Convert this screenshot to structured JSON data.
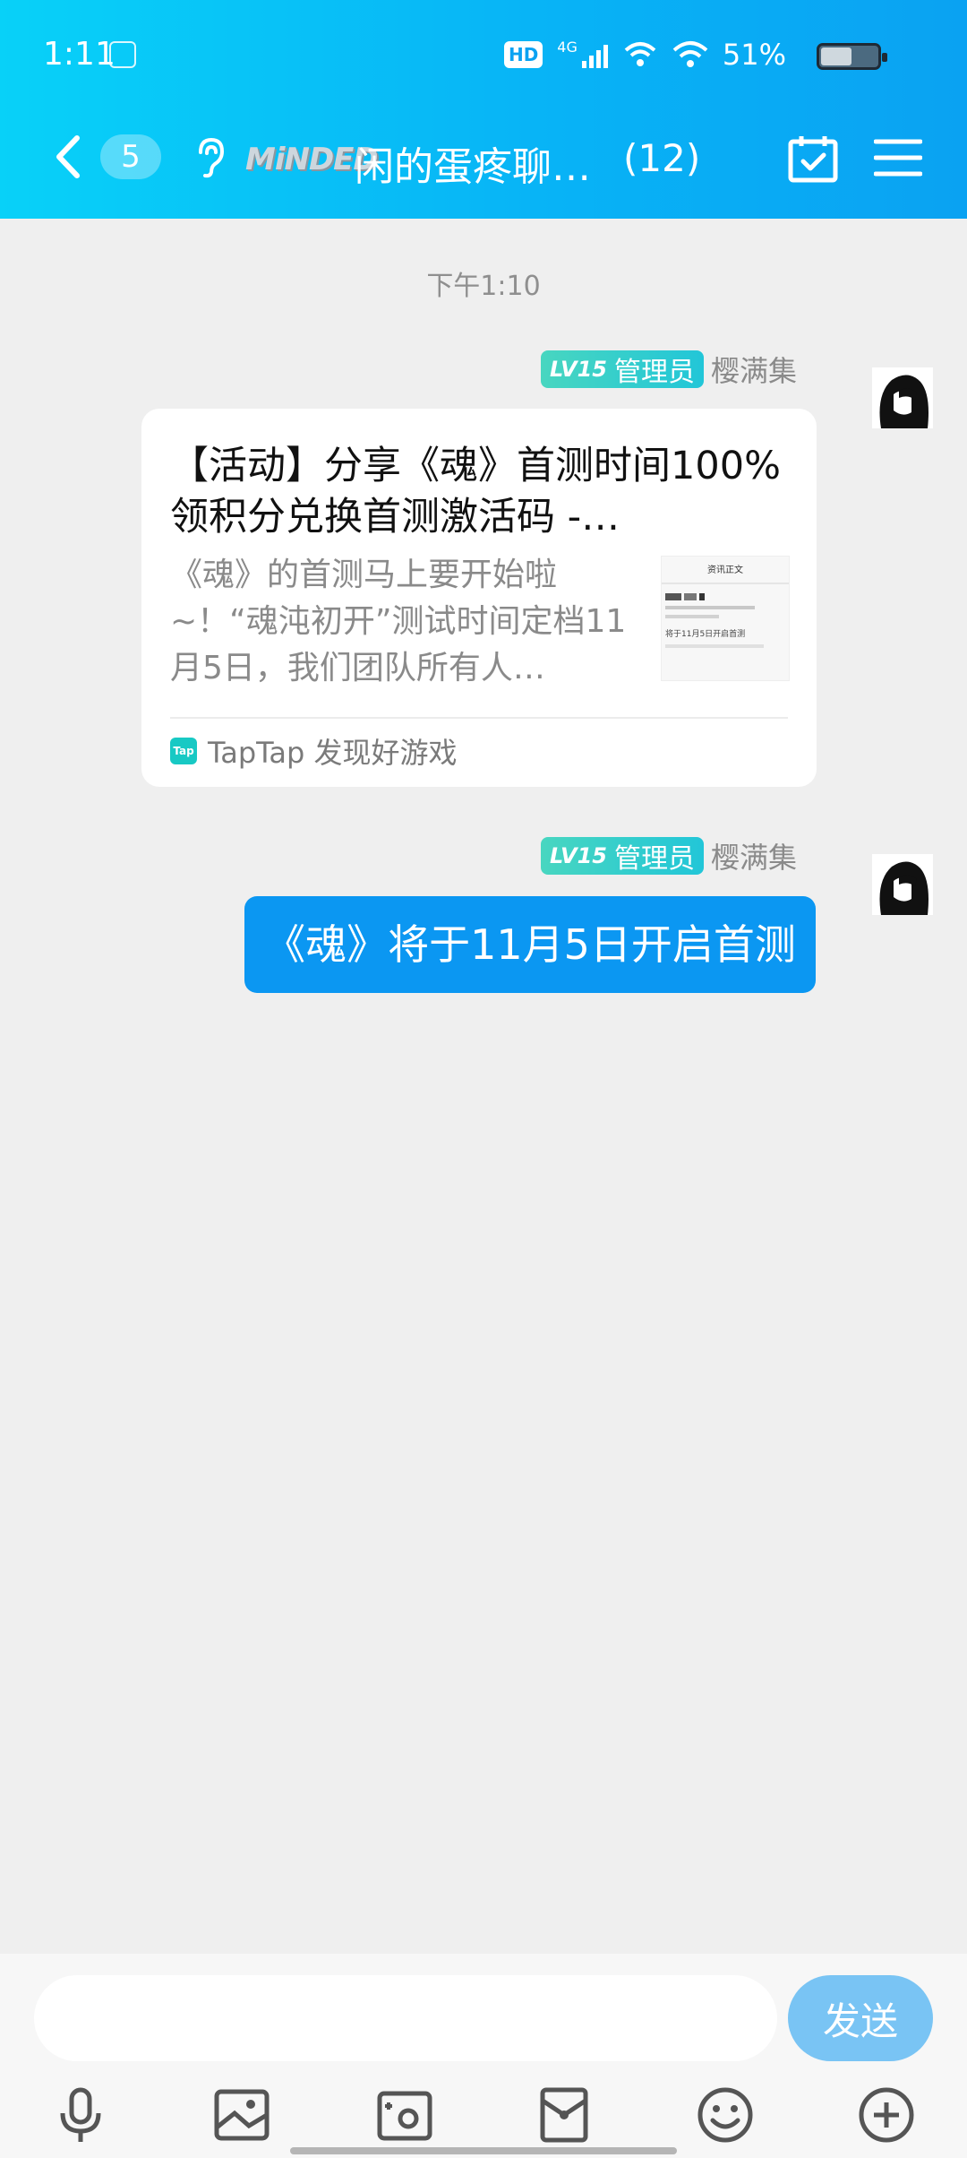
{
  "status_bar": {
    "time": "1:11",
    "hd": "HD",
    "network": "4G",
    "battery": "51%",
    "battery_level": 0.51
  },
  "header": {
    "unread_count": "5",
    "group_logo": "MiNDED",
    "group_name": "闲的蛋疼聊…",
    "member_count": "(12)"
  },
  "chat": {
    "timestamp": "下午1:10",
    "messages": [
      {
        "level": "LV15",
        "role": "管理员",
        "sender": "樱满集",
        "type": "link_card",
        "card": {
          "title": "【活动】分享《魂》首测时间100%领积分兑换首测激活码 -…",
          "description": "《魂》的首测马上要开始啦~！“魂沌初开”测试时间定档11月5日，我们团队所有人…",
          "source_icon": "Tap",
          "source": "TapTap  发现好游戏",
          "thumb_header": "资讯正文",
          "thumb_caption": "将于11月5日开启首测"
        }
      },
      {
        "level": "LV15",
        "role": "管理员",
        "sender": "樱满集",
        "type": "text",
        "text": "《魂》将于11月5日开启首测"
      }
    ]
  },
  "input": {
    "placeholder": "",
    "send_label": "发送"
  },
  "colors": {
    "header_start": "#08d1f8",
    "header_end": "#0aa2f2",
    "bubble": "#0b97f2",
    "send_button": "#79c4f4",
    "level_badge": "#2ccbd0"
  },
  "icons": [
    "back-icon",
    "ear-icon",
    "calendar-check-icon",
    "menu-icon",
    "microphone-icon",
    "image-icon",
    "camera-icon",
    "red-packet-icon",
    "emoji-icon",
    "plus-icon"
  ]
}
